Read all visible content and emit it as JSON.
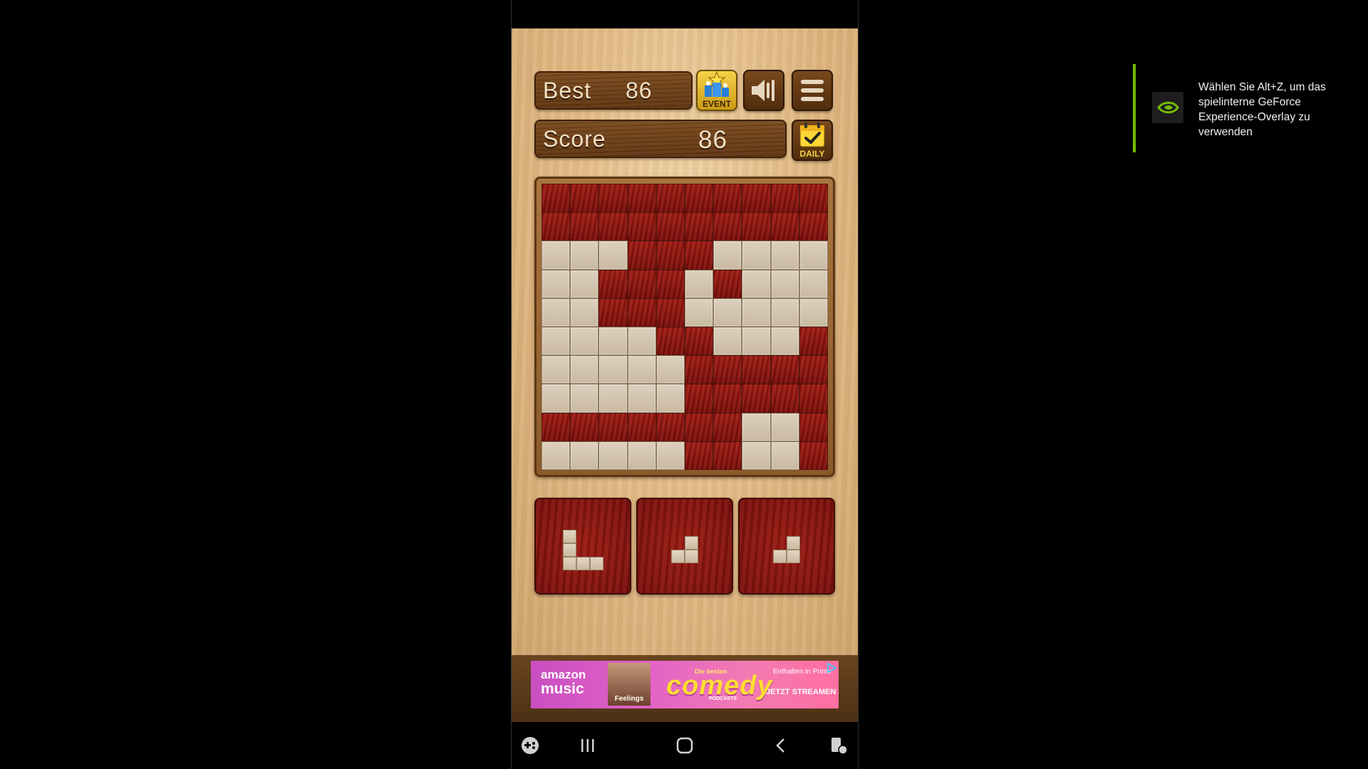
{
  "game": {
    "best_label": "Best",
    "best_value": "86",
    "score_label": "Score",
    "score_value": "86",
    "event_label": "EVENT",
    "daily_label": "DAILY",
    "board": [
      "RRRRRRRRRR",
      "RRRRRRRRRR",
      "EEERRREEEE",
      "EERRREREEE",
      "EERRREEEEE",
      "EEEERREEER",
      "EEEEERRRRR",
      "EEEEERRRRR",
      "RRRRRRREER",
      "EEEEERREER"
    ],
    "pieces": [
      {
        "name": "piece-L",
        "cells": [
          [
            0,
            0
          ],
          [
            0,
            1
          ],
          [
            0,
            2
          ],
          [
            1,
            2
          ],
          [
            2,
            2
          ]
        ]
      },
      {
        "name": "piece-J-small",
        "cells": [
          [
            1,
            0
          ],
          [
            0,
            1
          ],
          [
            1,
            1
          ]
        ]
      },
      {
        "name": "piece-J-small-2",
        "cells": [
          [
            1,
            0
          ],
          [
            0,
            1
          ],
          [
            1,
            1
          ]
        ]
      }
    ]
  },
  "ad": {
    "brand_top": "amazon",
    "brand_bottom": "music",
    "tagline_small": "Die besten",
    "headline": "comedy",
    "subline": "PODCASTS",
    "included": "Enthalten in Prime",
    "cta": "JETZT STREAMEN",
    "poster_text": "Feelings"
  },
  "overlay": {
    "text": "Wählen Sie Alt+Z, um das spielinterne GeForce Experience-Overlay zu verwenden",
    "accent_color": "#76b900"
  },
  "colors": {
    "block_red": "#8f130d",
    "empty_cell": "#d3c5b0"
  }
}
